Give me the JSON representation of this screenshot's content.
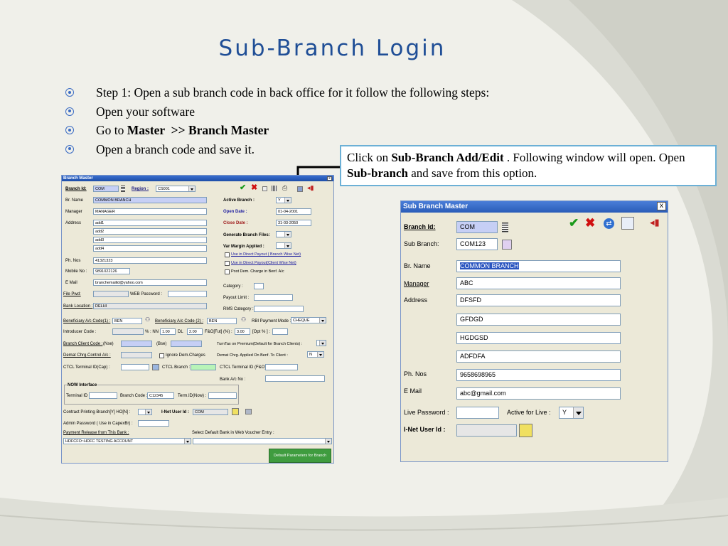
{
  "slide": {
    "title": "Sub-Branch Login",
    "bullets": [
      {
        "text": "Step 1: Open a sub branch code in back office for it follow the following steps:"
      },
      {
        "text": "Open your software"
      },
      {
        "pre": "Go to ",
        "b1": "Master",
        "mid": "  >> ",
        "b2": "Branch Master"
      },
      {
        "text": "Open a branch code and save it."
      }
    ],
    "callout": {
      "t1": "Click on ",
      "b1": "Sub-Branch Add/Edit",
      "t2": " . Following  window will open. Open ",
      "b2": "Sub-branch",
      "t3": "  and save from this option."
    }
  },
  "branch_master": {
    "title": "Branch Master",
    "close": "x",
    "branch_id_label": "Branch Id:",
    "branch_id": "COM",
    "region_label": "Region :",
    "region": "CS001",
    "br_name_label": "Br. Name",
    "br_name": "COMMON BRANCH",
    "manager_label": "Manager",
    "manager": "MANAGER",
    "address_label": "Address",
    "address": [
      "add1",
      "add2",
      "add3",
      "add4"
    ],
    "ph_nos_label": "Ph. Nos",
    "ph_nos": "41321323",
    "mobile_label": "Mobile No :",
    "mobile": "9891022126",
    "email_label": "E Mail",
    "email": "branchemailid@yahoo.com",
    "file_pwd_label": "File Pwd:",
    "web_password_label": "WEB Password :",
    "bank_location_label": "Bank Location :",
    "bank_location": "DELHI",
    "active_branch_label": "Active Branch :",
    "active_branch": "Y",
    "open_date_label": "Open Date :",
    "open_date": "01-04-2001",
    "close_date_label": "Close Date :",
    "close_date": "31-03-2050",
    "generate_files_label": "Generate Branch Files:",
    "var_margin_label": "Var Margin Applied :",
    "chk_direct_payout": "Use in Direct Payout ( Branch Wise Net)",
    "chk_direct_payout_client": "Use in Direct Payout(Client Wise Net)",
    "chk_post_dem": "Post Dem. Charge in Benf. A/c",
    "category_label": "Category :",
    "payout_limit_label": "Payout Limit :",
    "rms_category_label": "RMS Category :",
    "benef1_label": "Beneficiary A/c Code(1) :",
    "benef1": "BEN",
    "benef2_label": "Beneficiary A/c Code (2) :",
    "benef2": "BEN",
    "rbi_mode_label": "RBI Payment Mode :",
    "rbi_mode": "CHEQUE",
    "introducer_label": "Introducer Code :",
    "pct_nn_label": "% : NN",
    "pct_nn": "1.00",
    "dl_label": "DL",
    "dl": "2.00",
    "fo_label": "F&O[Fut] (%) :",
    "fo": "3.00",
    "opt_label": "[Opt % ] :",
    "branch_client_label": "Branch Client Code :",
    "nse_label": "(Nse)",
    "bse_label": "(Bse)",
    "turntax_label": "TurnTax on Premium(Default for Branch Clients) :",
    "demat_ac_label": "Demat Chrg.Control A/c :",
    "ignore_dem_label": "Ignore Dem.Charges",
    "demat_applied_label": "Demat Chrg. Applied On Benf. To Client :",
    "demat_applied": "N",
    "ctcl_cap_label": "CTCL Terminal ID(Cap) :",
    "ctcl_branch_label": "CTCL Branch :",
    "ctcl_fo_label": "CTCL Terminal ID (F&O) :",
    "bank_ac_label": "Bank A/c No :",
    "now_label": "NOW Interface",
    "terminal_id_label": "Terminal ID :",
    "branch_code_label": "Branch Code :",
    "branch_code": "C12345",
    "term_id_now_label": "Term.ID(Now) :",
    "contract_label": "Contract Printing Branch[Y] HO[N] :",
    "inet_label": "I-Net  User Id :",
    "inet": "COM",
    "admin_pwd_label": "Admin Password ( Use in CapexBr) :",
    "payment_release_label": "Payment Release from This Bank :",
    "payment_bank": "HDFCFO~HDFC TESTING ACCOUNT",
    "select_bank_label": "Select Default Bank in Web Voucher Entry :",
    "default_params_btn": "Default Parameters for Branch"
  },
  "sub_branch_master": {
    "title": "Sub Branch Master",
    "close": "x",
    "branch_id_label": "Branch Id:",
    "branch_id": "COM",
    "sub_branch_label": "Sub Branch:",
    "sub_branch": "COM123",
    "br_name_label": "Br. Name",
    "br_name": "COMMON BRANCH",
    "manager_label": "Manager",
    "manager": "ABC",
    "address_label": "Address",
    "address": [
      "DFSFD",
      "GFDGD",
      "HGDGSD",
      "ADFDFA"
    ],
    "ph_nos_label": "Ph. Nos",
    "ph_nos": "9658698965",
    "email_label": "E Mail",
    "email": "abc@gmail.com",
    "live_password_label": "Live Password :",
    "active_live_label": "Active for Live :",
    "active_live": "Y",
    "inet_label": "I-Net  User Id :"
  },
  "colors": {
    "title": "#1f4e96",
    "bullet": "#3b6cc4",
    "callout_border": "#6cb0d6",
    "titlebar": "#1d4ea8"
  },
  "icons": [
    "bullet-circle-icon",
    "check-icon",
    "cross-icon",
    "refresh-icon",
    "document-icon",
    "exit-door-icon",
    "list-icon",
    "print-icon",
    "lookup-icon",
    "calendar-icon"
  ]
}
